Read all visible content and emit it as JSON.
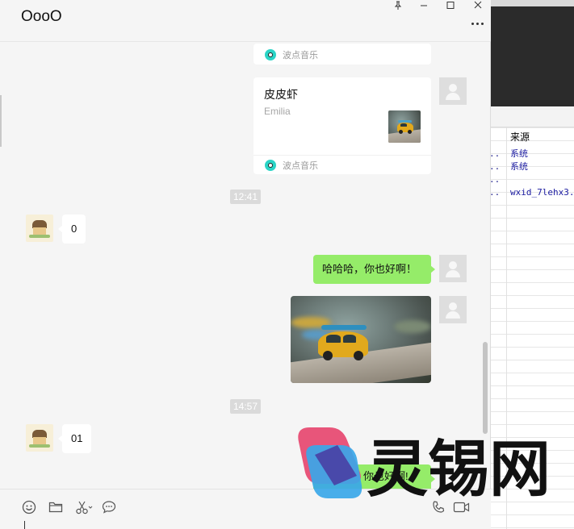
{
  "chat": {
    "title": "OooO",
    "messages": {
      "music_card_1": {
        "source": "波点音乐"
      },
      "music_card_2": {
        "song": "皮皮虾",
        "artist": "Emilia",
        "source": "波点音乐"
      },
      "time_1": "12:41",
      "recv_1": "0",
      "sent_text": "哈哈哈，你也好啊！",
      "time_2": "14:57",
      "recv_2": "01",
      "partial_sent": "你也好啊!"
    }
  },
  "background_app": {
    "column_header": "来源",
    "rows": [
      {
        "prefix": "..",
        "value": "系统"
      },
      {
        "prefix": "..",
        "value": "系统"
      },
      {
        "prefix": "..",
        "value": ""
      },
      {
        "prefix": "..",
        "value": "wxid_7lehx3..."
      }
    ]
  },
  "watermark": {
    "text": "灵锡网"
  },
  "icons": [
    "pin-icon",
    "minimize-icon",
    "maximize-icon",
    "close-icon",
    "more-icon",
    "emoji-icon",
    "folder-icon",
    "scissors-icon",
    "chat-history-icon",
    "voice-call-icon",
    "video-call-icon",
    "music-app-icon"
  ],
  "colors": {
    "sent_bubble": "#95ec69",
    "received_bubble": "#ffffff",
    "chat_bg": "#f5f5f5",
    "accent_watermark_red": "#e8557a",
    "accent_watermark_blue": "#3aa7e8"
  }
}
